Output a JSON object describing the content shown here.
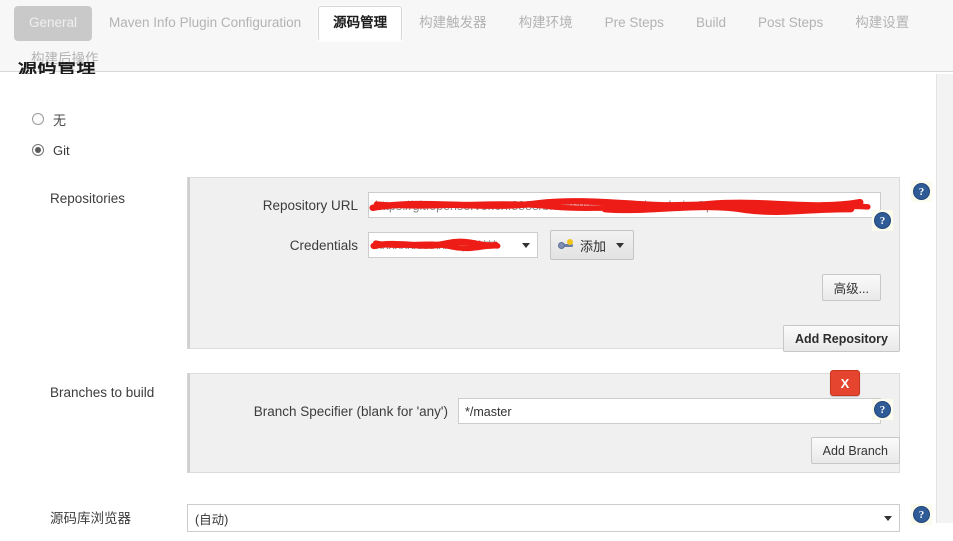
{
  "tabs": {
    "row1": [
      {
        "label": "General",
        "state": "hovered"
      },
      {
        "label": "Maven Info Plugin Configuration",
        "state": "normal"
      },
      {
        "label": "源码管理",
        "state": "active"
      },
      {
        "label": "构建触发器",
        "state": "normal"
      },
      {
        "label": "构建环境",
        "state": "normal"
      },
      {
        "label": "Pre Steps",
        "state": "normal"
      },
      {
        "label": "Build",
        "state": "normal"
      },
      {
        "label": "Post Steps",
        "state": "normal"
      },
      {
        "label": "构建设置",
        "state": "normal"
      }
    ],
    "row2": [
      {
        "label": "构建后操作",
        "state": "normal"
      }
    ]
  },
  "section": {
    "heading": "源码管理"
  },
  "scm_options": [
    {
      "label": "无",
      "selected": false
    },
    {
      "label": "Git",
      "selected": true
    }
  ],
  "repositories": {
    "label": "Repositories",
    "repository_url": {
      "label": "Repository URL",
      "value": "https://git.openserver.cn:8888/blockchain/eth/Turbo-chain-Open-Java.git",
      "redacted": true
    },
    "credentials": {
      "label": "Credentials",
      "value": "xxxxxxxxxxxxxq/******",
      "redacted": true,
      "add_button": {
        "label": "添加",
        "icon": "key-icon"
      }
    },
    "advanced_button": "高级...",
    "add_repository_button": "Add Repository"
  },
  "branches": {
    "label": "Branches to build",
    "delete_button": "X",
    "branch_specifier": {
      "label": "Branch Specifier (blank for 'any')",
      "value": "*/master"
    },
    "add_branch_button": "Add Branch"
  },
  "repository_browser": {
    "label": "源码库浏览器",
    "value": "(自动)"
  },
  "help_icon": "?",
  "colors": {
    "accent_blue": "#2f5b96",
    "delete_red": "#e5452f",
    "redaction_red": "#ee1c16",
    "panel_bg": "#f0f0f0"
  }
}
